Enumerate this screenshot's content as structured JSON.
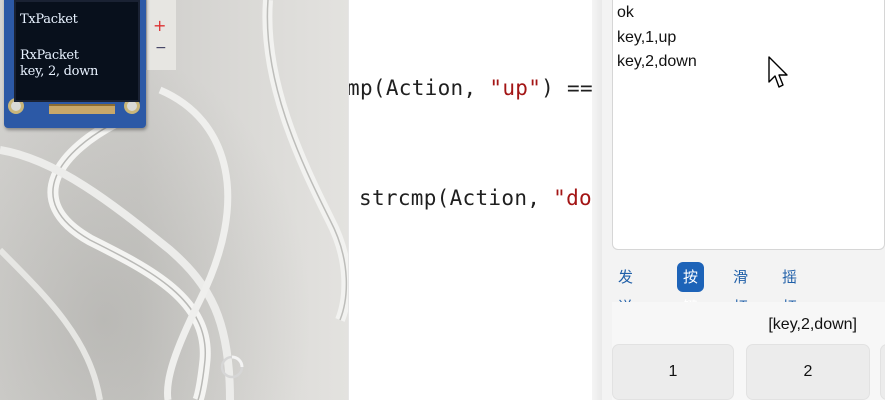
{
  "photo": {
    "oled_lines": [
      "TxPacket",
      "RxPacket",
      "key, 2, down"
    ]
  },
  "editor": {
    "line1_prefix": "mp(Action, ",
    "line1_string": "\"up\"",
    "line1_suffix": ") ==",
    "line2_prefix": "strcmp(Action, ",
    "line2_string": "\"do"
  },
  "serial": {
    "rx_lines": [
      "ok",
      "key,1,up",
      "key,2,down"
    ],
    "tabs": [
      {
        "label": "发送区",
        "active": false
      },
      {
        "label": "按键",
        "active": true
      },
      {
        "label": "滑杆",
        "active": false
      },
      {
        "label": "摇杆",
        "active": false
      }
    ],
    "key_display": "[key,2,down]",
    "buttons": [
      "1",
      "2"
    ]
  },
  "colors": {
    "tab_active": "#1d63b8",
    "tab_text": "#1f5fa8",
    "code_string": "#a31515",
    "oled_board": "#2c59a6"
  }
}
